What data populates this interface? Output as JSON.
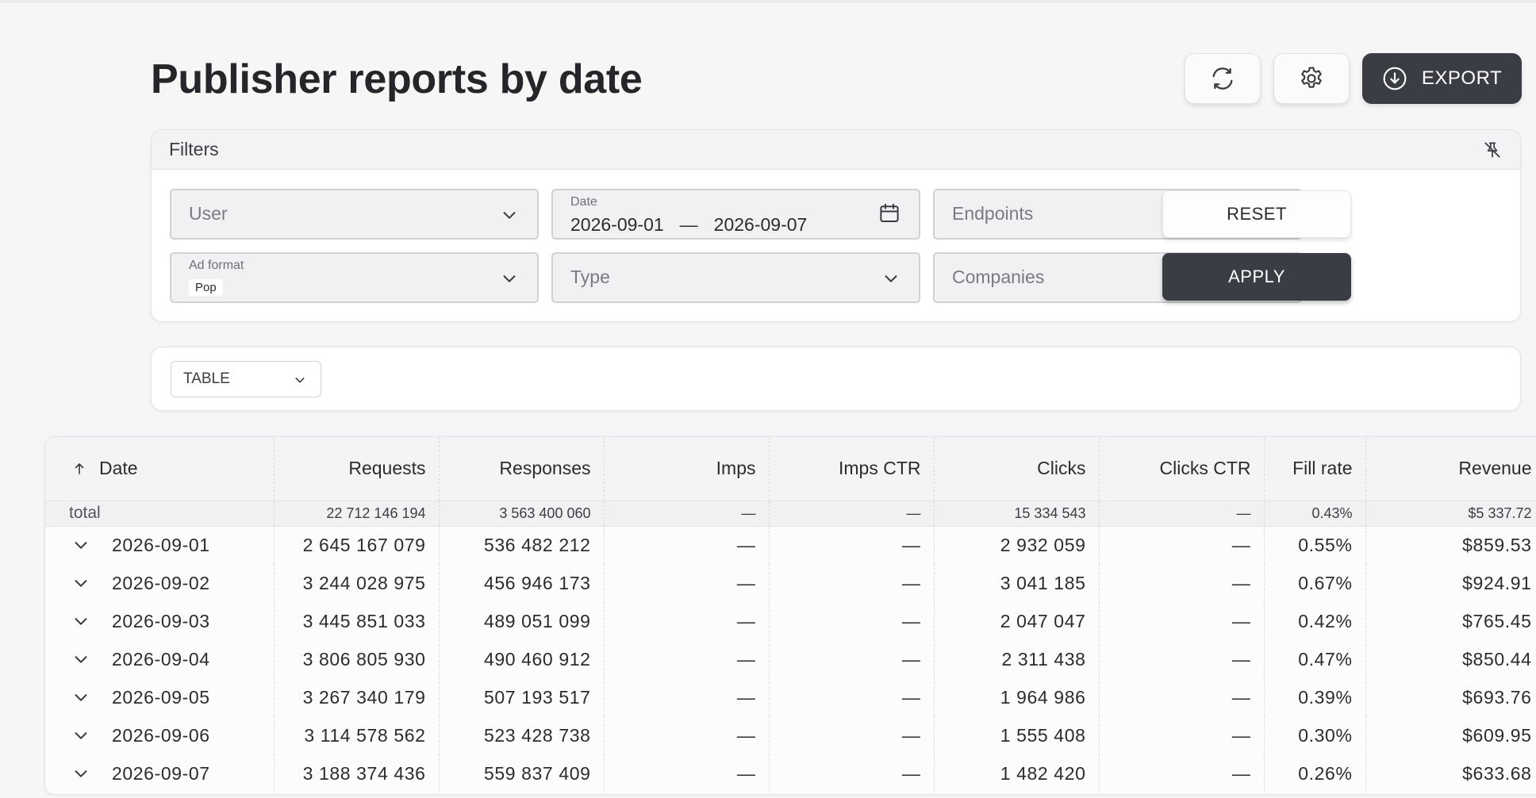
{
  "header": {
    "title": "Publisher reports by date",
    "export_label": "EXPORT"
  },
  "icons": {
    "refresh": "refresh-icon",
    "settings": "gear-icon",
    "export": "download-icon",
    "unpin": "unpin-icon",
    "calendar": "calendar-icon",
    "chevron": "chevron-down-icon",
    "sort": "arrow-up-icon"
  },
  "colors": {
    "primary_dark": "#3b3d45",
    "page_bg": "#f6f6f7"
  },
  "filters": {
    "title": "Filters",
    "user_placeholder": "User",
    "date_label": "Date",
    "date_from": "2026-09-01",
    "date_sep": "—",
    "date_to": "2026-09-07",
    "endpoints_placeholder": "Endpoints",
    "ad_format_label": "Ad format",
    "ad_format_chip": "Pop",
    "type_placeholder": "Type",
    "companies_placeholder": "Companies",
    "reset_label": "RESET",
    "apply_label": "APPLY"
  },
  "view": {
    "selected": "TABLE"
  },
  "table": {
    "columns": [
      "Date",
      "Requests",
      "Responses",
      "Imps",
      "Imps CTR",
      "Clicks",
      "Clicks CTR",
      "Fill rate",
      "Revenue"
    ],
    "total": [
      "total",
      "22 712 146 194",
      "3 563 400 060",
      "—",
      "—",
      "15 334 543",
      "—",
      "0.43%",
      "$5 337.72"
    ],
    "rows": [
      [
        "2026-09-01",
        "2 645 167 079",
        "536 482 212",
        "—",
        "—",
        "2 932 059",
        "—",
        "0.55%",
        "$859.53"
      ],
      [
        "2026-09-02",
        "3 244 028 975",
        "456 946 173",
        "—",
        "—",
        "3 041 185",
        "—",
        "0.67%",
        "$924.91"
      ],
      [
        "2026-09-03",
        "3 445 851 033",
        "489 051 099",
        "—",
        "—",
        "2 047 047",
        "—",
        "0.42%",
        "$765.45"
      ],
      [
        "2026-09-04",
        "3 806 805 930",
        "490 460 912",
        "—",
        "—",
        "2 311 438",
        "—",
        "0.47%",
        "$850.44"
      ],
      [
        "2026-09-05",
        "3 267 340 179",
        "507 193 517",
        "—",
        "—",
        "1 964 986",
        "—",
        "0.39%",
        "$693.76"
      ],
      [
        "2026-09-06",
        "3 114 578 562",
        "523 428 738",
        "—",
        "—",
        "1 555 408",
        "—",
        "0.30%",
        "$609.95"
      ],
      [
        "2026-09-07",
        "3 188 374 436",
        "559 837 409",
        "—",
        "—",
        "1 482 420",
        "—",
        "0.26%",
        "$633.68"
      ]
    ]
  }
}
